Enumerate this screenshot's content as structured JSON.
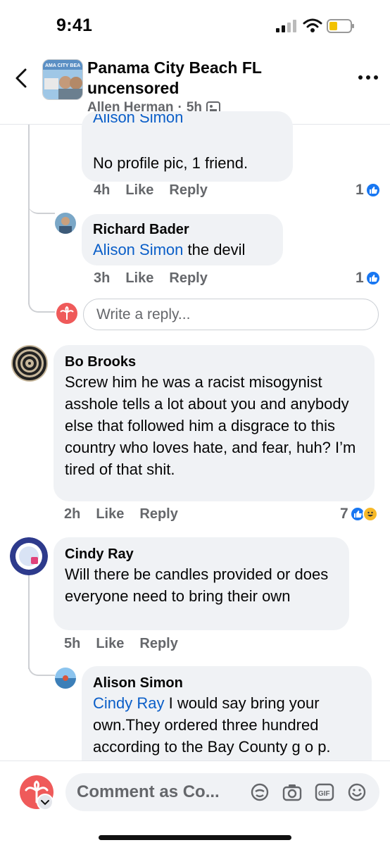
{
  "status_bar": {
    "time": "9:41"
  },
  "header": {
    "group_title": "Panama City Beach FL uncensored",
    "author": "Allen Herman",
    "time": "5h",
    "group_avatar_text": "AMA CITY BEA"
  },
  "comments": [
    {
      "author": "",
      "text": "No profile pic, 1 friend.",
      "partial_top": "Alison Simon",
      "time": "4h",
      "like": "Like",
      "reply": "Reply",
      "reactions": "1"
    },
    {
      "author": "Richard Bader",
      "mention": "Alison Simon",
      "text": " the devil",
      "time": "3h",
      "like": "Like",
      "reply": "Reply",
      "reactions": "1"
    },
    {
      "author": "Bo Brooks",
      "text": "Screw him he was a racist misogynist asshole tells a lot about you and anybody else that followed him a disgrace to this country  who loves hate, and fear, huh? I’m tired of that shit.",
      "time": "2h",
      "like": "Like",
      "reply": "Reply",
      "reactions": "7"
    },
    {
      "author": "Cindy Ray",
      "text": "Will there be candles provided or does everyone need to bring their own",
      "time": "5h",
      "like": "Like",
      "reply": "Reply"
    },
    {
      "author": "Alison Simon",
      "mention": "Cindy Ray",
      "text": " I would say bring your own.They ordered three hundred according to the Bay County g o p. and it's not going to be"
    }
  ],
  "reply_input": {
    "placeholder": "Write a reply..."
  },
  "comment_bar": {
    "placeholder": "Comment as Co..."
  },
  "colors": {
    "accent": "#1877f2",
    "mention": "#0a5ec8",
    "bubble": "#f0f2f5",
    "muted": "#65676b"
  },
  "icons": [
    "back-arrow-icon",
    "photo-icon",
    "more-icon",
    "like-icon",
    "haha-icon",
    "avatar-sticker-icon",
    "camera-icon",
    "gif-icon",
    "emoji-icon"
  ]
}
